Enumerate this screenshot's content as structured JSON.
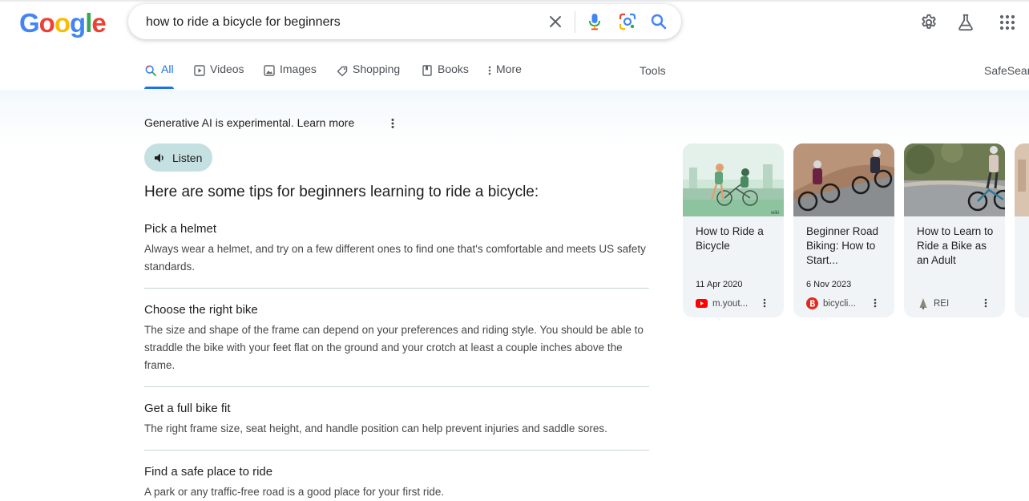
{
  "logo": [
    "G",
    "o",
    "o",
    "g",
    "l",
    "e"
  ],
  "logo_colors": [
    "#4285f4",
    "#ea4335",
    "#fbbc05",
    "#4285f4",
    "#34a853",
    "#ea4335"
  ],
  "search": {
    "query": "how to ride a bicycle for beginners"
  },
  "header_icons": [
    "settings-icon",
    "labs-flask-icon",
    "apps-grid-icon"
  ],
  "tabs": [
    {
      "label": "All",
      "icon": "search-icon",
      "active": true
    },
    {
      "label": "Videos",
      "icon": "play-icon"
    },
    {
      "label": "Images",
      "icon": "image-icon"
    },
    {
      "label": "Shopping",
      "icon": "tag-icon"
    },
    {
      "label": "Books",
      "icon": "book-icon"
    },
    {
      "label": "More",
      "icon": "kebab-icon"
    }
  ],
  "tools_label": "Tools",
  "safesearch_label": "SafeSearch",
  "ai": {
    "notice": "Generative AI is experimental.",
    "learn_more": "Learn more",
    "listen_label": "Listen",
    "heading": "Here are some tips for beginners learning to ride a bicycle:",
    "tips": [
      {
        "title": "Pick a helmet",
        "body": "Always wear a helmet, and try on a few different ones to find one that's comfortable and meets US safety standards."
      },
      {
        "title": "Choose the right bike",
        "body": "The size and shape of the frame can depend on your preferences and riding style. You should be able to straddle the bike with your feet flat on the ground and your crotch at least a couple inches above the frame."
      },
      {
        "title": "Get a full bike fit",
        "body": "The right frame size, seat height, and handle position can help prevent injuries and saddle sores."
      },
      {
        "title": "Find a safe place to ride",
        "body": "A park or any traffic-free road is a good place for your first ride."
      }
    ]
  },
  "cards": [
    {
      "title": "How to Ride a Bicycle",
      "date": "11 Apr 2020",
      "source": "m.yout...",
      "favicon": "youtube-icon",
      "thumb_label": "wiki"
    },
    {
      "title": "Beginner Road Biking: How to Start...",
      "date": "6 Nov 2023",
      "source": "bicycli...",
      "favicon": "bicycling-icon"
    },
    {
      "title": "How to Learn to Ride a Bike as an Adult",
      "date": "",
      "source": "REI",
      "favicon": "rei-icon"
    }
  ],
  "colors": {
    "accent": "#1a73e8",
    "listen_bg": "#c4e0e0",
    "card_bg": "#f1f4f7"
  }
}
